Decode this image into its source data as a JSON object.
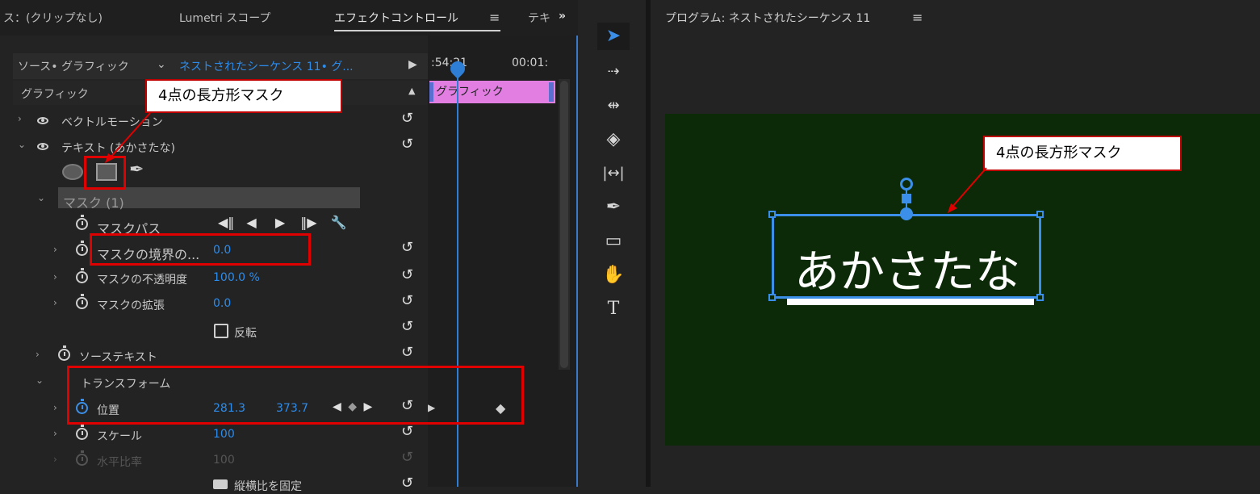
{
  "tabs": {
    "source": "ス：(クリップなし)",
    "lumetri": "Lumetri スコープ",
    "effect_controls": "エフェクトコントロール",
    "text": "テキ",
    "more": "»"
  },
  "source_bar": {
    "source_label": "ソース• グラフィック",
    "sequence_label": "ネストされたシーケンス 11• グ...",
    "timecode_left": ":54:21",
    "timecode_right": "00:01:"
  },
  "section_header": "グラフィック",
  "clip_label": "グラフィック",
  "rows": {
    "vector_motion": "ベクトルモーション",
    "text_layer": "テキスト (あかさたな)",
    "mask_group": "マスク (1)",
    "mask_path": "マスクパス",
    "mask_feather_label": "マスクの境界の...",
    "mask_feather_value": "0.0",
    "mask_opacity_label": "マスクの不透明度",
    "mask_opacity_value": "100.0 %",
    "mask_expansion_label": "マスクの拡張",
    "mask_expansion_value": "0.0",
    "inverted_label": "反転",
    "source_text": "ソーステキスト",
    "transform": "トランスフォーム",
    "position_label": "位置",
    "position_x": "281.3",
    "position_y": "373.7",
    "scale_label": "スケール",
    "scale_value": "100",
    "horizontal_ratio_label": "水平比率",
    "horizontal_ratio_value": "100",
    "uniform_scale_label": "縦横比を固定"
  },
  "callouts": {
    "left": "4点の長方形マスク",
    "right": "4点の長方形マスク"
  },
  "program": {
    "title": "プログラム: ネストされたシーケンス 11",
    "screen_text": "あかさたな"
  },
  "colors": {
    "accent": "#2d8ceb",
    "clip": "#e27ee2",
    "highlight_box": "#e00000",
    "screen_bg": "#0c2a08"
  },
  "icons": {
    "ellipse_tool": "ellipse-mask-icon",
    "rect_tool": "rectangle-mask-icon",
    "pen_tool": "pen-mask-icon"
  }
}
